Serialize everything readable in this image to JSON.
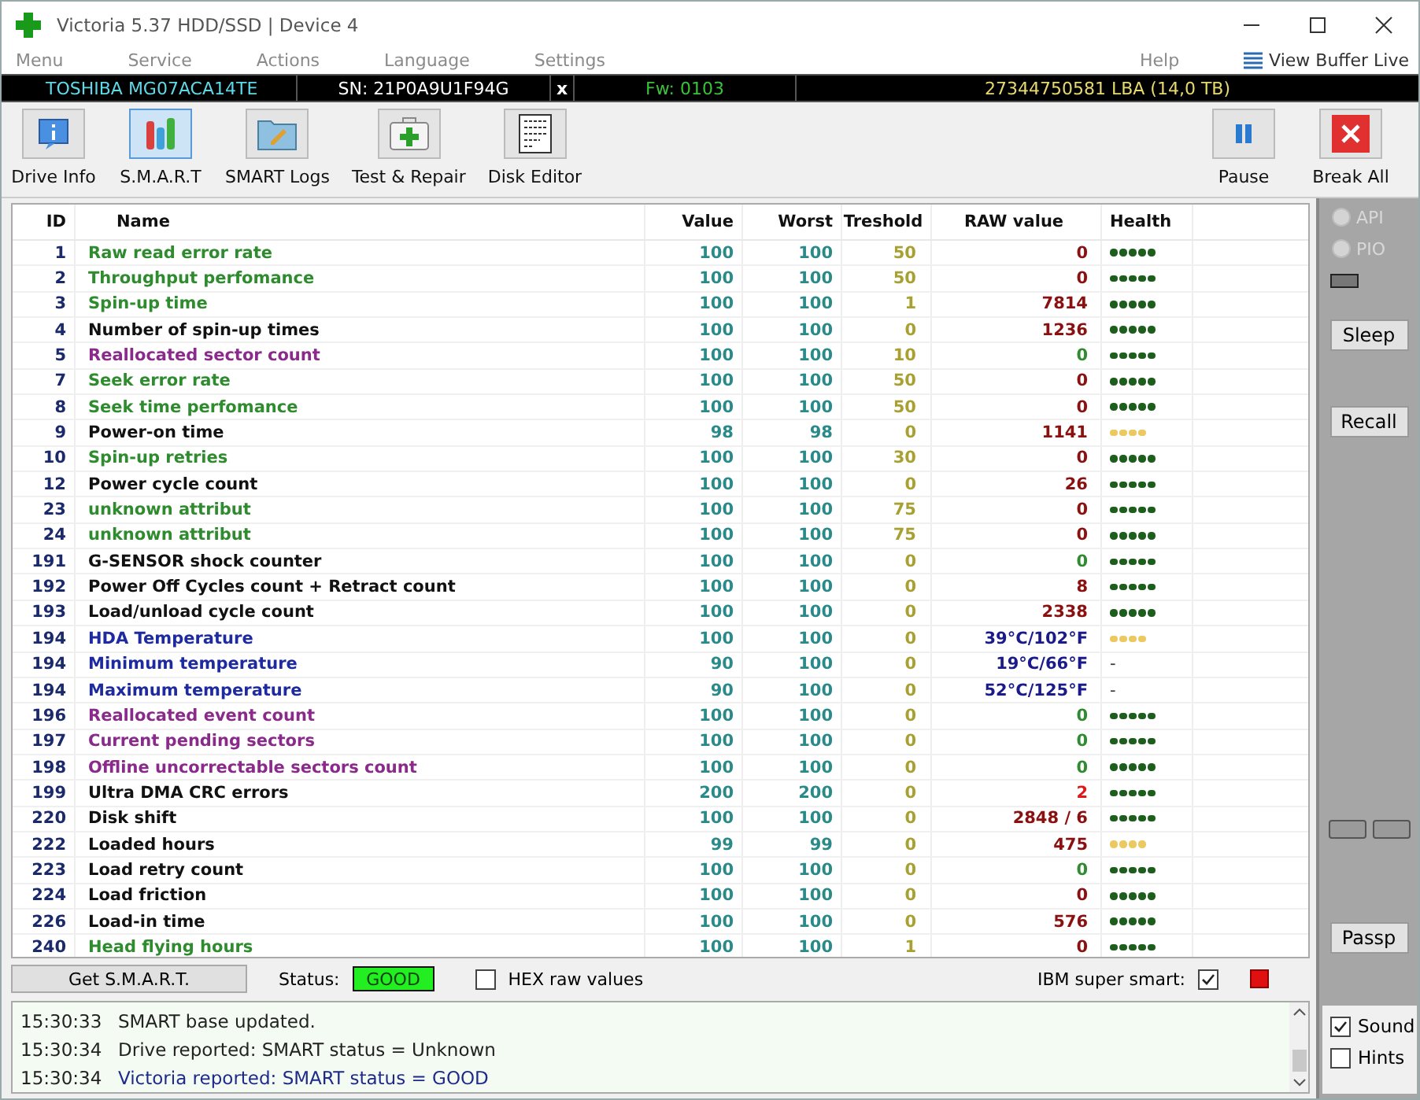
{
  "window": {
    "title": "Victoria 5.37 HDD/SSD | Device 4"
  },
  "menu": [
    {
      "label": "Menu"
    },
    {
      "label": "Service"
    },
    {
      "label": "Actions"
    },
    {
      "label": "Language"
    },
    {
      "label": "Settings"
    }
  ],
  "help_menu": "Help",
  "view_buffer": "View Buffer Live",
  "drive": {
    "model": "TOSHIBA MG07ACA14TE",
    "serial": "SN: 21P0A9U1F94G",
    "close": "x",
    "firmware": "Fw: 0103",
    "capacity": "27344750581 LBA (14,0 TB)"
  },
  "toolbar": [
    {
      "label": "Drive Info",
      "kind": "info",
      "selected": false
    },
    {
      "label": "S.M.A.R.T",
      "kind": "smart",
      "selected": true
    },
    {
      "label": "SMART Logs",
      "kind": "logs",
      "selected": false
    },
    {
      "label": "Test & Repair",
      "kind": "test",
      "selected": false
    },
    {
      "label": "Disk Editor",
      "kind": "editor",
      "selected": false
    }
  ],
  "toolbar_right": [
    {
      "label": "Pause",
      "kind": "pause"
    },
    {
      "label": "Break All",
      "kind": "break"
    }
  ],
  "table": {
    "columns": [
      "ID",
      "Name",
      "Value",
      "Worst",
      "Treshold",
      "RAW value",
      "Health"
    ],
    "rows": [
      {
        "id": "1",
        "name": "Raw read error rate",
        "kind": "ok",
        "value": "100",
        "worst": "100",
        "threshold": "50",
        "raw": {
          "text": "0",
          "color": "#8b1010"
        },
        "health": {
          "stars": 5,
          "color": "#1d5e1d"
        }
      },
      {
        "id": "2",
        "name": "Throughput perfomance",
        "kind": "ok",
        "value": "100",
        "worst": "100",
        "threshold": "50",
        "raw": {
          "text": "0",
          "color": "#8b1010"
        },
        "health": {
          "stars": 5,
          "color": "#1d5e1d"
        }
      },
      {
        "id": "3",
        "name": "Spin-up time",
        "kind": "ok",
        "value": "100",
        "worst": "100",
        "threshold": "1",
        "raw": {
          "text": "7814",
          "color": "#8b1010"
        },
        "health": {
          "stars": 5,
          "color": "#1d5e1d"
        }
      },
      {
        "id": "4",
        "name": "Number of spin-up times",
        "kind": "normal",
        "value": "100",
        "worst": "100",
        "threshold": "0",
        "raw": {
          "text": "1236",
          "color": "#8b1010"
        },
        "health": {
          "stars": 5,
          "color": "#1d5e1d"
        }
      },
      {
        "id": "5",
        "name": "Reallocated sector count",
        "kind": "critical",
        "value": "100",
        "worst": "100",
        "threshold": "10",
        "raw": {
          "text": "0",
          "color": "#2e8b2e"
        },
        "health": {
          "stars": 5,
          "color": "#1d5e1d"
        }
      },
      {
        "id": "7",
        "name": "Seek error rate",
        "kind": "ok",
        "value": "100",
        "worst": "100",
        "threshold": "50",
        "raw": {
          "text": "0",
          "color": "#8b1010"
        },
        "health": {
          "stars": 5,
          "color": "#1d5e1d"
        }
      },
      {
        "id": "8",
        "name": "Seek time perfomance",
        "kind": "ok",
        "value": "100",
        "worst": "100",
        "threshold": "50",
        "raw": {
          "text": "0",
          "color": "#8b1010"
        },
        "health": {
          "stars": 5,
          "color": "#1d5e1d"
        }
      },
      {
        "id": "9",
        "name": "Power-on time",
        "kind": "normal",
        "value": "98",
        "worst": "98",
        "threshold": "0",
        "raw": {
          "text": "1141",
          "color": "#8b1010"
        },
        "health": {
          "stars": 4,
          "color": "#ecc860"
        }
      },
      {
        "id": "10",
        "name": "Spin-up retries",
        "kind": "ok",
        "value": "100",
        "worst": "100",
        "threshold": "30",
        "raw": {
          "text": "0",
          "color": "#8b1010"
        },
        "health": {
          "stars": 5,
          "color": "#1d5e1d"
        }
      },
      {
        "id": "12",
        "name": "Power cycle count",
        "kind": "normal",
        "value": "100",
        "worst": "100",
        "threshold": "0",
        "raw": {
          "text": "26",
          "color": "#8b1010"
        },
        "health": {
          "stars": 5,
          "color": "#1d5e1d"
        }
      },
      {
        "id": "23",
        "name": "unknown attribut",
        "kind": "ok",
        "value": "100",
        "worst": "100",
        "threshold": "75",
        "raw": {
          "text": "0",
          "color": "#8b1010"
        },
        "health": {
          "stars": 5,
          "color": "#1d5e1d"
        }
      },
      {
        "id": "24",
        "name": "unknown attribut",
        "kind": "ok",
        "value": "100",
        "worst": "100",
        "threshold": "75",
        "raw": {
          "text": "0",
          "color": "#8b1010"
        },
        "health": {
          "stars": 5,
          "color": "#1d5e1d"
        }
      },
      {
        "id": "191",
        "name": "G-SENSOR shock counter",
        "kind": "normal",
        "value": "100",
        "worst": "100",
        "threshold": "0",
        "raw": {
          "text": "0",
          "color": "#2e8b2e"
        },
        "health": {
          "stars": 5,
          "color": "#1d5e1d"
        }
      },
      {
        "id": "192",
        "name": "Power Off Cycles count + Retract count",
        "kind": "normal",
        "value": "100",
        "worst": "100",
        "threshold": "0",
        "raw": {
          "text": "8",
          "color": "#8b1010"
        },
        "health": {
          "stars": 5,
          "color": "#1d5e1d"
        }
      },
      {
        "id": "193",
        "name": "Load/unload cycle count",
        "kind": "normal",
        "value": "100",
        "worst": "100",
        "threshold": "0",
        "raw": {
          "text": "2338",
          "color": "#8b1010"
        },
        "health": {
          "stars": 5,
          "color": "#1d5e1d"
        }
      },
      {
        "id": "194",
        "name": "HDA Temperature",
        "kind": "temp",
        "value": "100",
        "worst": "100",
        "threshold": "0",
        "raw": {
          "text": "39°C/102°F",
          "color": "#1a1a8b"
        },
        "health": {
          "stars": 4,
          "color": "#ecc860"
        }
      },
      {
        "id": "194",
        "name": "Minimum temperature",
        "kind": "temp",
        "value": "90",
        "worst": "100",
        "threshold": "0",
        "raw": {
          "text": "19°C/66°F",
          "color": "#1a1a8b"
        },
        "health": {
          "text": "-"
        }
      },
      {
        "id": "194",
        "name": "Maximum temperature",
        "kind": "temp",
        "value": "90",
        "worst": "100",
        "threshold": "0",
        "raw": {
          "text": "52°C/125°F",
          "color": "#1a1a8b"
        },
        "health": {
          "text": "-"
        }
      },
      {
        "id": "196",
        "name": "Reallocated event count",
        "kind": "critical",
        "value": "100",
        "worst": "100",
        "threshold": "0",
        "raw": {
          "text": "0",
          "color": "#2e8b2e"
        },
        "health": {
          "stars": 5,
          "color": "#1d5e1d"
        }
      },
      {
        "id": "197",
        "name": "Current pending sectors",
        "kind": "critical",
        "value": "100",
        "worst": "100",
        "threshold": "0",
        "raw": {
          "text": "0",
          "color": "#2e8b2e"
        },
        "health": {
          "stars": 5,
          "color": "#1d5e1d"
        }
      },
      {
        "id": "198",
        "name": "Offline uncorrectable sectors count",
        "kind": "critical",
        "value": "100",
        "worst": "100",
        "threshold": "0",
        "raw": {
          "text": "0",
          "color": "#2e8b2e"
        },
        "health": {
          "stars": 5,
          "color": "#1d5e1d"
        }
      },
      {
        "id": "199",
        "name": "Ultra DMA CRC errors",
        "kind": "normal",
        "value": "200",
        "worst": "200",
        "threshold": "0",
        "raw": {
          "text": "2",
          "color": "#e01818"
        },
        "health": {
          "stars": 5,
          "color": "#1d5e1d"
        }
      },
      {
        "id": "220",
        "name": "Disk shift",
        "kind": "normal",
        "value": "100",
        "worst": "100",
        "threshold": "0",
        "raw": {
          "text": "2848 / 6",
          "color": "#8b1010"
        },
        "health": {
          "stars": 5,
          "color": "#1d5e1d"
        }
      },
      {
        "id": "222",
        "name": "Loaded hours",
        "kind": "normal",
        "value": "99",
        "worst": "99",
        "threshold": "0",
        "raw": {
          "text": "475",
          "color": "#8b1010"
        },
        "health": {
          "stars": 4,
          "color": "#ecc860"
        }
      },
      {
        "id": "223",
        "name": "Load retry count",
        "kind": "normal",
        "value": "100",
        "worst": "100",
        "threshold": "0",
        "raw": {
          "text": "0",
          "color": "#2e8b2e"
        },
        "health": {
          "stars": 5,
          "color": "#1d5e1d"
        }
      },
      {
        "id": "224",
        "name": "Load friction",
        "kind": "normal",
        "value": "100",
        "worst": "100",
        "threshold": "0",
        "raw": {
          "text": "0",
          "color": "#8b1010"
        },
        "health": {
          "stars": 5,
          "color": "#1d5e1d"
        }
      },
      {
        "id": "226",
        "name": "Load-in time",
        "kind": "normal",
        "value": "100",
        "worst": "100",
        "threshold": "0",
        "raw": {
          "text": "576",
          "color": "#8b1010"
        },
        "health": {
          "stars": 5,
          "color": "#1d5e1d"
        }
      },
      {
        "id": "240",
        "name": "Head flying hours",
        "kind": "ok",
        "value": "100",
        "worst": "100",
        "threshold": "1",
        "raw": {
          "text": "0",
          "color": "#8b1010"
        },
        "health": {
          "stars": 5,
          "color": "#1d5e1d"
        }
      }
    ]
  },
  "status_bar": {
    "get_button": "Get S.M.A.R.T.",
    "status_label": "Status:",
    "status": "GOOD",
    "hex": {
      "label": "HEX raw values",
      "checked": false
    },
    "ibm": {
      "label": "IBM super smart:",
      "checked": true
    }
  },
  "log": [
    {
      "time": "15:30:33",
      "message": "SMART base updated.",
      "kind": "info"
    },
    {
      "time": "15:30:34",
      "message": "Drive reported: SMART status = Unknown",
      "kind": "info"
    },
    {
      "time": "15:30:34",
      "message": "Victoria reported: SMART status = GOOD",
      "kind": "result"
    }
  ],
  "side": {
    "modes": [
      {
        "label": "API",
        "selected": false
      },
      {
        "label": "PIO",
        "selected": false
      }
    ],
    "sleep": "Sleep",
    "recall": "Recall",
    "passp": "Passp",
    "options": [
      {
        "label": "Sound",
        "checked": true
      },
      {
        "label": "Hints",
        "checked": false
      }
    ]
  }
}
